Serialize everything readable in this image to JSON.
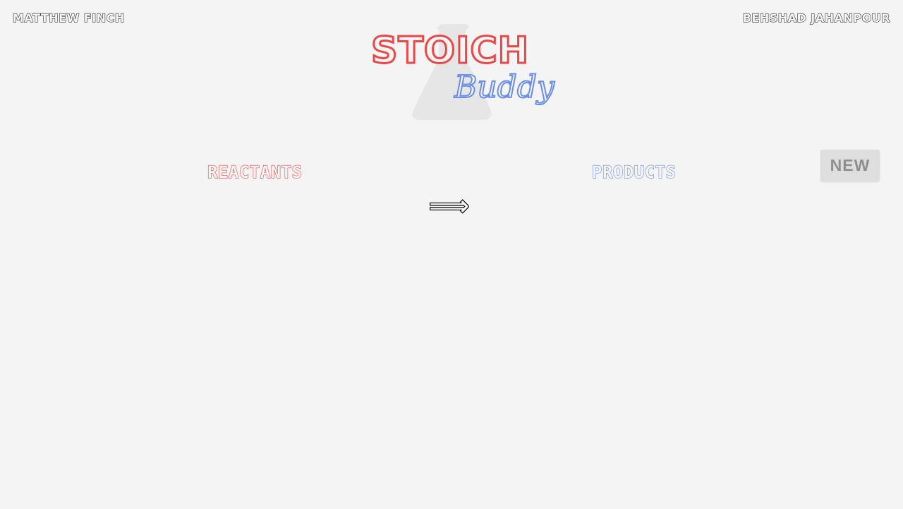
{
  "authors": {
    "left": "MATTHEW FINCH",
    "right": "BEHSHAD JAHANPOUR"
  },
  "logo": {
    "word1": "STOICH",
    "word2": "Buddy",
    "word1_color": "#e84848",
    "word2_color": "#6a8de6",
    "background_icon": "flask-icon"
  },
  "toolbar": {
    "new_label": "NEW"
  },
  "equation": {
    "reactants_label": "REACTANTS",
    "products_label": "PRODUCTS",
    "arrow": "⟹",
    "reactants_color": "#e84848",
    "products_color": "#6a8de6"
  }
}
